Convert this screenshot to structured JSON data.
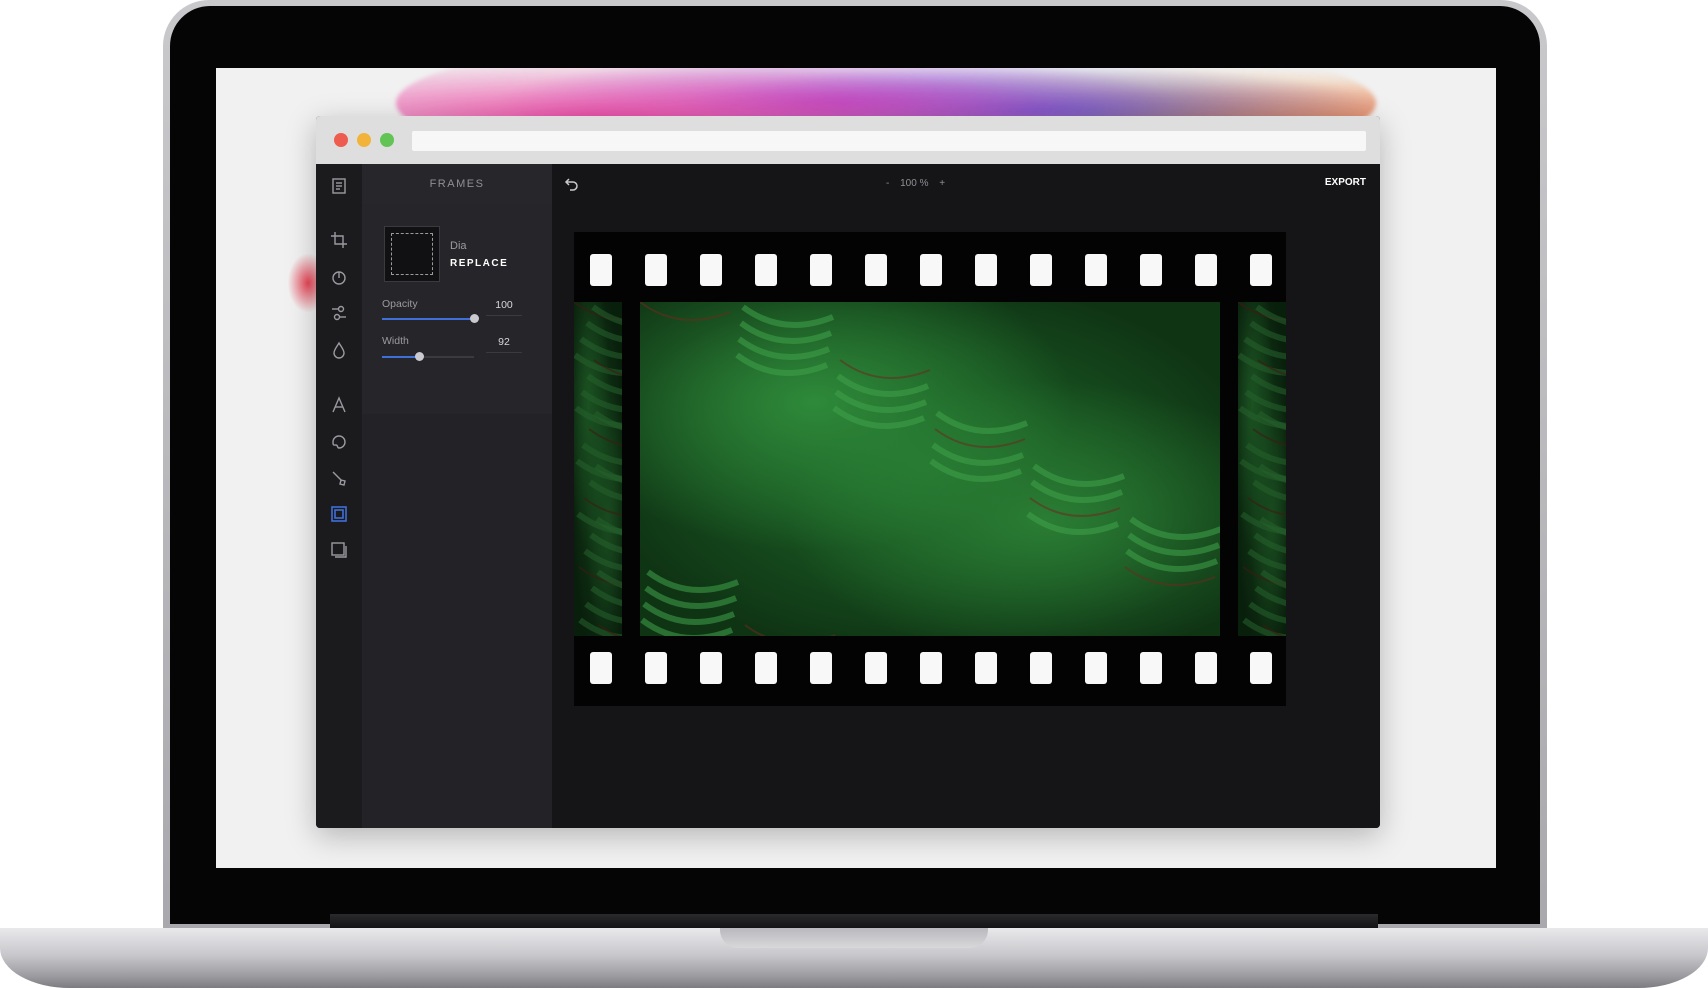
{
  "window": {
    "title": ""
  },
  "sidebar": {
    "tools": [
      {
        "name": "pages-icon"
      },
      {
        "name": "crop-icon"
      },
      {
        "name": "filter-icon"
      },
      {
        "name": "adjust-icon"
      },
      {
        "name": "drop-icon"
      },
      {
        "name": "text-icon"
      },
      {
        "name": "sticker-icon"
      },
      {
        "name": "brush-icon"
      },
      {
        "name": "frame-icon",
        "active": true
      },
      {
        "name": "overlay-icon"
      }
    ]
  },
  "panel": {
    "header": "FRAMES",
    "frame_name": "Dia",
    "replace_label": "REPLACE",
    "opacity": {
      "label": "Opacity",
      "value": "100",
      "level": 1.0
    },
    "width": {
      "label": "Width",
      "value": "92",
      "level": 0.4
    }
  },
  "toolbar": {
    "zoom_minus": "-",
    "zoom_value": "100 %",
    "zoom_plus": "+",
    "export_label": "EXPORT"
  },
  "colors": {
    "accent": "#3f6fd8",
    "app_bg": "#18181b",
    "panel_bg": "#232327"
  }
}
